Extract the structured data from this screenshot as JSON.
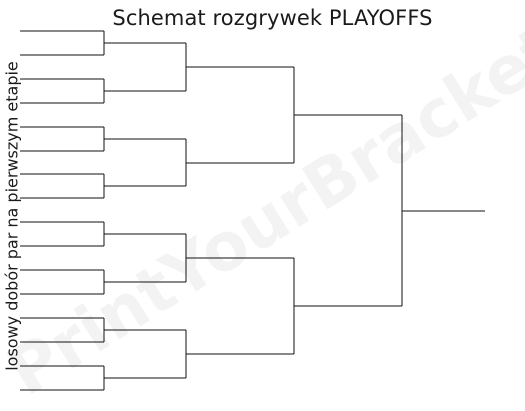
{
  "title": "Schemat rozgrywek PLAYOFFS",
  "side_label": "losowy dobór par na pierwszym etapie",
  "watermark": "PrintYourBrackets",
  "bracket": {
    "teams": 16,
    "rounds": 4,
    "line_color": "#111111"
  }
}
